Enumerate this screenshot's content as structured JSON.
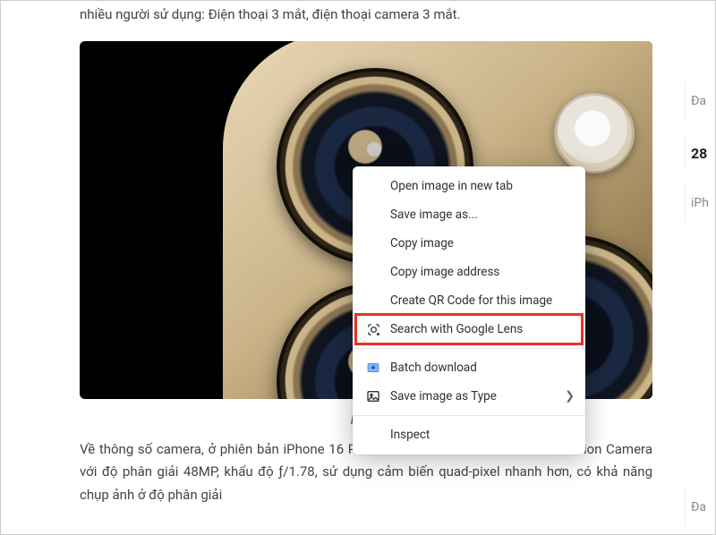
{
  "article": {
    "top_text": "nhiều người sử dụng: Điện thoại 3 mắt, điện thoại camera 3 mắt.",
    "caption": "Nguồ",
    "bottom_text": "Về thông số camera, ở phiên bản iPhone 16 Pro thì camera chính đổi tên thành Fusion Camera với độ phân giải 48MP, khẩu độ ƒ/1.78, sử dụng cảm biến quad-pixel nhanh hơn, có khả năng chụp ảnh ở độ phân giải"
  },
  "sidebar": {
    "frag1": "Đa",
    "frag_bold": "28",
    "frag2": "iPh",
    "frag3": "Đa"
  },
  "context_menu": {
    "open_new_tab": "Open image in new tab",
    "save_as": "Save image as...",
    "copy_image": "Copy image",
    "copy_address": "Copy image address",
    "create_qr": "Create QR Code for this image",
    "search_lens": "Search with Google Lens",
    "batch_download": "Batch download",
    "save_as_type": "Save image as Type",
    "inspect": "Inspect"
  }
}
